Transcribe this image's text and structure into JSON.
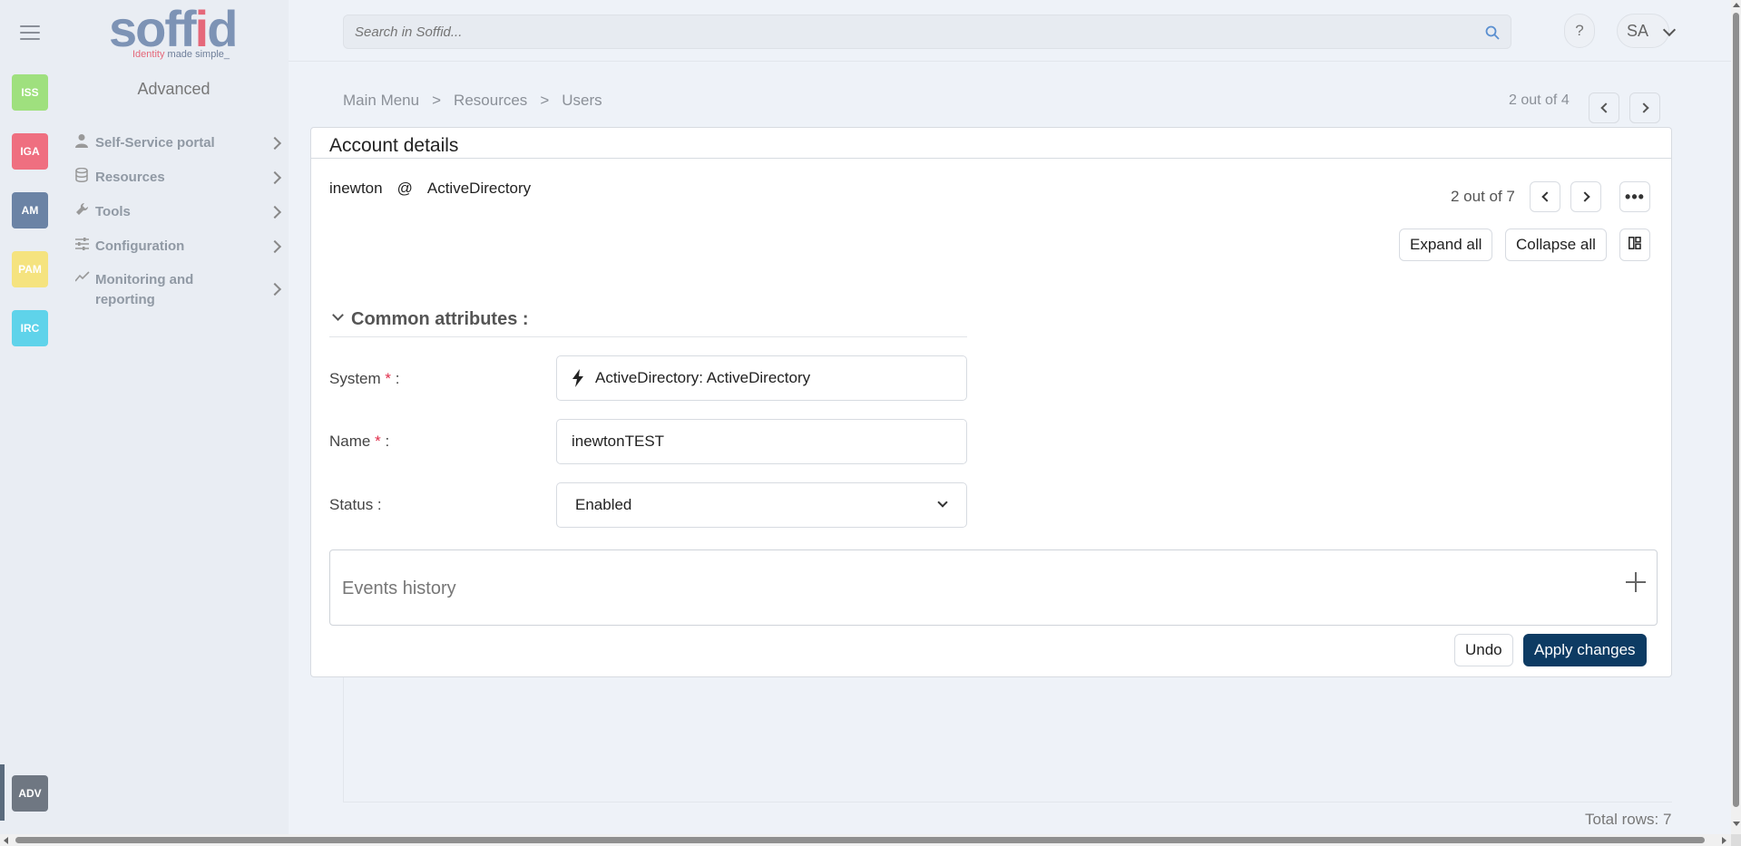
{
  "rail": {
    "apps": [
      {
        "label": "ISS",
        "color": "#9fe07e"
      },
      {
        "label": "IGA",
        "color": "#ef6f80"
      },
      {
        "label": "AM",
        "color": "#6b83a5"
      },
      {
        "label": "PAM",
        "color": "#f5e37f"
      },
      {
        "label": "IRC",
        "color": "#5fd3ea"
      }
    ],
    "active_app": {
      "label": "ADV",
      "color": "#6f7782"
    }
  },
  "logo": {
    "wordmark_pre": "soff",
    "wordmark_accent": "i",
    "wordmark_post": "d",
    "tagline_red": "Identity",
    "tagline_rest": " made simple_"
  },
  "sidebar": {
    "heading": "Advanced",
    "items": [
      {
        "label": "Self-Service portal",
        "icon": "user-icon"
      },
      {
        "label": "Resources",
        "icon": "database-icon"
      },
      {
        "label": "Tools",
        "icon": "wrench-icon"
      },
      {
        "label": "Configuration",
        "icon": "sliders-icon"
      },
      {
        "label": "Monitoring and reporting",
        "icon": "chart-line-icon"
      }
    ]
  },
  "topbar": {
    "search_placeholder": "Search in Soffid...",
    "help_label": "?",
    "user_initials": "SA"
  },
  "breadcrumb": {
    "items": [
      "Main Menu",
      "Resources",
      "Users"
    ],
    "separator": ">"
  },
  "pager_top": {
    "text": "2 out of 4"
  },
  "card": {
    "title": "Account details",
    "account_name": "inewton",
    "at": "@",
    "system_name": "ActiveDirectory",
    "pager_text": "2 out of 7",
    "more_label": "•••",
    "expand_all": "Expand all",
    "collapse_all": "Collapse all",
    "section_title": "Common attributes :",
    "fields": {
      "system": {
        "label": "System",
        "required": "*",
        "suffix": " :",
        "value": "ActiveDirectory: ActiveDirectory"
      },
      "name": {
        "label": "Name",
        "required": "*",
        "suffix": " :",
        "value": "inewtonTEST"
      },
      "status": {
        "label": "Status :",
        "value": "Enabled"
      }
    },
    "events_title": "Events history",
    "undo": "Undo",
    "apply": "Apply changes"
  },
  "footer": {
    "total_rows": "Total rows: 7"
  }
}
